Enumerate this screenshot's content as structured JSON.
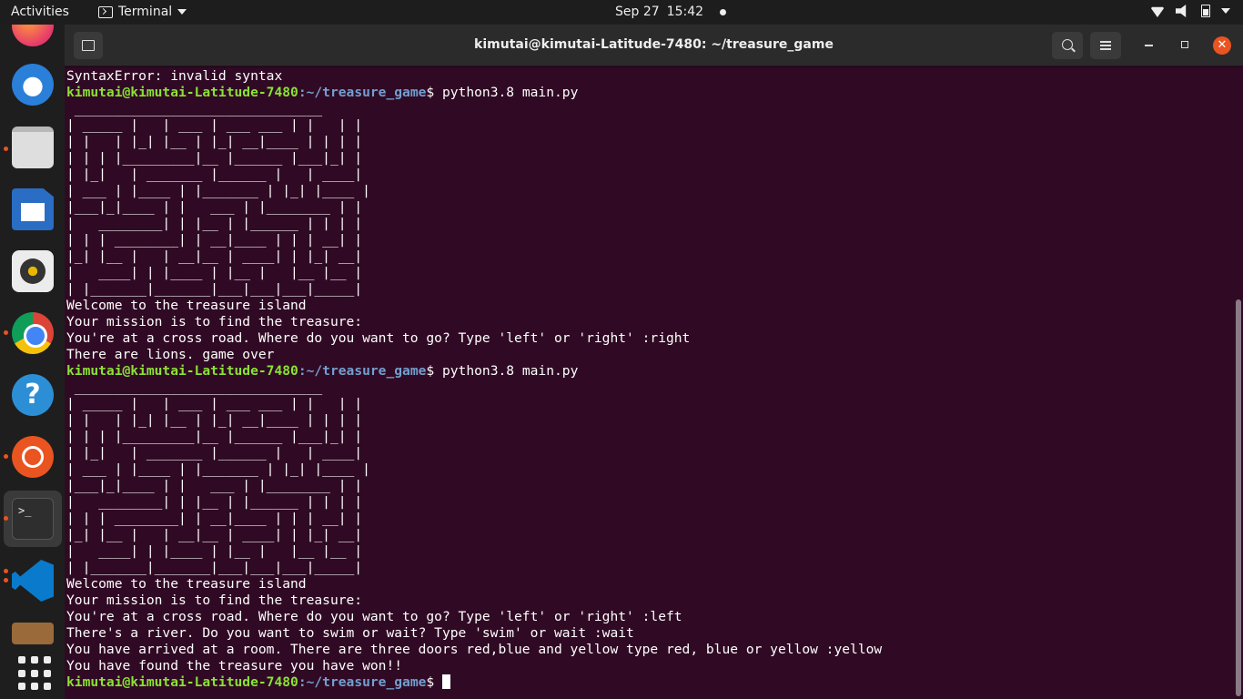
{
  "topbar": {
    "activities": "Activities",
    "app_name": "Terminal",
    "date": "Sep 27",
    "time": "15:42"
  },
  "dock": {
    "items": [
      "firefox",
      "thunderbird",
      "files",
      "libreoffice-writer",
      "rhythmbox",
      "chrome",
      "help",
      "ubuntu-software",
      "terminal",
      "vscode",
      "briefcase",
      "show-applications"
    ]
  },
  "window": {
    "title": "kimutai@kimutai-Latitude-7480: ~/treasure_game"
  },
  "terminal": {
    "user_host": "kimutai@kimutai-Latitude-7480",
    "path": ":~/treasure_game",
    "prompt_sym": "$ ",
    "line_syntax_error": "SyntaxError: invalid syntax",
    "cmd": "python3.8 main.py",
    "art": " _______________________________\n| _____ |   | ___ | ___ ___ | |   | |\n| |   | |_| |__ | |_| __|____ | | | |\n| | | |_________|__ |______ |___|_| |\n| |_|   | _______ |______ |   | ____|\n| ___ | |____ | |_______ | |_| |____ |\n|___|_|____ | |   ___ | |________ | |\n|   ________| | |__ | |______ | | | |\n| | | ________| | __|____ | | | __| |\n|_| |__ |   | __|__ | ____| | |_| __|\n|   ____| | |____ | |__ |   |__ |__ |\n| |_______|_______|___|___|___|_____|",
    "welcome": "Welcome to the treasure island",
    "mission": "Your mission is to find the treasure:",
    "crossroad_prefix": "You're at a cross road. Where do you want to go? Type 'left' or 'right' :",
    "run1_answer": "right",
    "lions": "There are lions. game over",
    "run2_answer": "left",
    "river": "There's a river. Do you want to swim or wait? Type 'swim' or wait :wait",
    "room": "You have arrived at a room. There are three doors red,blue and yellow type red, blue or yellow :yellow",
    "won": "You have found the treasure you have won!!"
  },
  "colors": {
    "terminal_bg": "#300a24",
    "prompt_user": "#8ae234",
    "prompt_path": "#729fcf",
    "close_button": "#e95420"
  }
}
